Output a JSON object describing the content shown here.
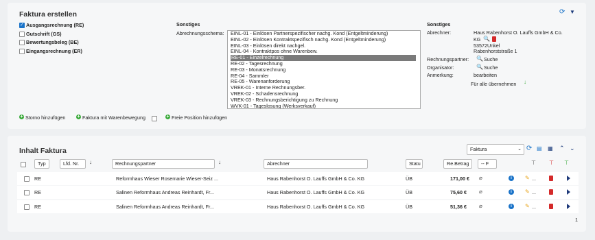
{
  "top": {
    "title": "Faktura erstellen",
    "checkboxes": [
      {
        "label": "Ausgangsrechnung (RE)",
        "checked": true
      },
      {
        "label": "Gutschrift (GS)",
        "checked": false
      },
      {
        "label": "Bewertungsbeleg (BE)",
        "checked": false
      },
      {
        "label": "Eingangsrechnung (ER)",
        "checked": false
      }
    ],
    "sonstiges_mid": "Sonstiges",
    "abrechnungsschema_label": "Abrechnungsschema:",
    "schema_options": [
      "EINL-01 - Einlösen Partnerspezifischer nachg. Kond (Entgeltminderung)",
      "EINL-02 - Einlösen Kontraktspezifisch nachg. Kond (Entgeltminderung)",
      "EINL-03 - Einlösen direkt nachgel.",
      "EINL-04 - Kontraktpos ohne Warenbew.",
      "RE-01 - Einzelrechnung",
      "RE-02 - Tagesrechnung",
      "RE-03 - Monatsrechnung",
      "RE-04 - Sammler",
      "RE-05 - Warenanforderung",
      "VREK-01 - Interne Rechnungsber.",
      "VREK-02 - Schadensrechnung",
      "VREK-03 - Rechnungsberichtigung zu Rechnung",
      "WVK-01 - Tageslosung (Werksverkauf)"
    ],
    "selected_schema_index": 4,
    "sonstiges_right": "Sonstiges",
    "abrechner_label": "Abrechner:",
    "abrechner_line1": "Haus Rabenhorst O. Lauffs GmbH & Co.",
    "abrechner_line2": "KG",
    "abrechner_line3": "53572Unkel",
    "abrechner_line4": "Rabenhorststraße 1",
    "rechnungspartner_label": "Rechnungspartner:",
    "organisator_label": "Organisator:",
    "suche": "Suche",
    "anmerkung_label": "Anmerkung:",
    "anmerkung_value": "bearbeiten",
    "fuer_alle": "Für alle übernehmen",
    "storno": "Storno hinzufügen",
    "faktura_waren": "Faktura mit Warenbewegung",
    "freie_position": "Freie Position hinzufügen"
  },
  "bottom": {
    "title": "Inhalt Faktura",
    "select_value": "Faktura",
    "filters": {
      "typ": "Typ",
      "lfd": "Lfd. Nr.",
      "rechnungspartner": "Rechnungspartner",
      "abrechner": "Abrechner",
      "status": "Statu",
      "betrag": "Re.Betrag",
      "currency": "-- F"
    },
    "rows": [
      {
        "typ": "RE",
        "partner": "Reformhaus Wieser Rosemarie Wieser-Seiz ...",
        "abrechner": "Haus Rabenhorst O. Lauffs GmbH & Co. KG",
        "status": "ÜB",
        "betrag": "171,00 €",
        "more": "..."
      },
      {
        "typ": "RE",
        "partner": "Salinen Reformhaus Andreas Reinhardt, Fr...",
        "abrechner": "Haus Rabenhorst O. Lauffs GmbH & Co. KG",
        "status": "ÜB",
        "betrag": "75,60 €",
        "more": "..."
      },
      {
        "typ": "RE",
        "partner": "Salinen Reformhaus Andreas Reinhardt, Fr...",
        "abrechner": "Haus Rabenhorst O. Lauffs GmbH & Co. KG",
        "status": "ÜB",
        "betrag": "51,36 €",
        "more": "..."
      }
    ],
    "page": "1"
  },
  "colors": {
    "accent": "#1a73c8",
    "green": "#3aaa3a",
    "danger": "#d42a2a"
  }
}
